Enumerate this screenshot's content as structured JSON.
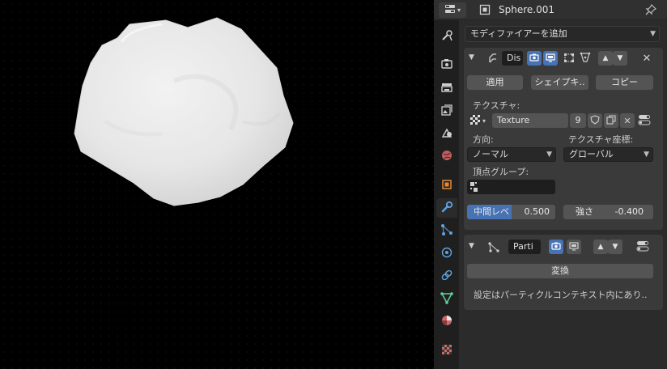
{
  "header": {
    "object_name": "Sphere.001"
  },
  "tabs": [
    {
      "name": "tool",
      "icon": "tool-icon"
    },
    {
      "name": "render",
      "icon": "camera-back-icon"
    },
    {
      "name": "output",
      "icon": "printer-icon"
    },
    {
      "name": "view-layer",
      "icon": "image-stack-icon"
    },
    {
      "name": "scene",
      "icon": "scene-icon"
    },
    {
      "name": "world",
      "icon": "world-icon"
    },
    {
      "name": "object",
      "icon": "object-icon"
    },
    {
      "name": "modifiers",
      "icon": "wrench-icon",
      "active": true
    },
    {
      "name": "particles",
      "icon": "particles-icon"
    },
    {
      "name": "physics",
      "icon": "physics-icon"
    },
    {
      "name": "constraints",
      "icon": "constraint-icon"
    },
    {
      "name": "data",
      "icon": "mesh-data-icon"
    },
    {
      "name": "material",
      "icon": "material-icon"
    },
    {
      "name": "texture",
      "icon": "texture-icon"
    }
  ],
  "add_modifier": {
    "label": "モディファイアーを追加"
  },
  "displace": {
    "name": "Dis",
    "apply_label": "適用",
    "shape_key_label": "シェイプキ..",
    "copy_label": "コピー",
    "texture_label": "テクスチャ:",
    "texture_name": "Texture",
    "texture_users": "9",
    "direction_label": "方向:",
    "direction_value": "ノーマル",
    "coords_label": "テクスチャ座標:",
    "coords_value": "グローバル",
    "vgroup_label": "頂点グループ:",
    "midlevel_label": "中間レベ",
    "midlevel_value": "0.500",
    "midlevel_fraction": 0.5,
    "strength_label": "強さ",
    "strength_value": "-0.400"
  },
  "particles": {
    "name": "Parti",
    "convert_label": "変換",
    "info_text": "設定はパーティクルコンテキスト内にあり.."
  },
  "colors": {
    "accent": "#4772b3",
    "panel": "#3a3a3a",
    "button": "#545454"
  }
}
